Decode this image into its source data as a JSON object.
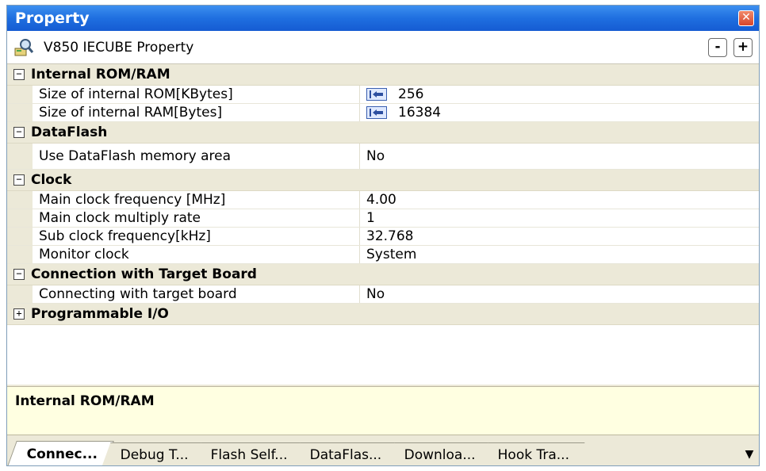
{
  "window": {
    "title": "Property",
    "close_glyph": "✕"
  },
  "toolbar": {
    "panel_name": "V850 IECUBE Property",
    "collapse_label": "-",
    "expand_label": "+",
    "icon": "property-icon"
  },
  "categories": [
    {
      "label": "Internal ROM/RAM",
      "toggle": "−",
      "props": [
        {
          "name": "Size of internal ROM[KBytes]",
          "value": "256",
          "ref": true
        },
        {
          "name": "Size of internal RAM[Bytes]",
          "value": "16384",
          "ref": true
        }
      ]
    },
    {
      "label": "DataFlash",
      "toggle": "−",
      "props": [
        {
          "name": "Use DataFlash memory area",
          "value": "No"
        }
      ]
    },
    {
      "label": "Clock",
      "toggle": "−",
      "props": [
        {
          "name": "Main clock frequency [MHz]",
          "value": "4.00"
        },
        {
          "name": "Main clock multiply rate",
          "value": "1"
        },
        {
          "name": "Sub clock frequency[kHz]",
          "value": "32.768"
        },
        {
          "name": "Monitor clock",
          "value": "System"
        }
      ]
    },
    {
      "label": "Connection with Target Board",
      "toggle": "−",
      "props": [
        {
          "name": "Connecting with target board",
          "value": "No"
        }
      ]
    },
    {
      "label": "Programmable I/O",
      "toggle": "+",
      "props": []
    }
  ],
  "description": {
    "title": "Internal ROM/RAM"
  },
  "tabs": [
    {
      "label": "Connec...",
      "active": true
    },
    {
      "label": "Debug T...",
      "active": false
    },
    {
      "label": "Flash Self...",
      "active": false
    },
    {
      "label": "DataFlas...",
      "active": false
    },
    {
      "label": "Downloa...",
      "active": false
    },
    {
      "label": "Hook Tra...",
      "active": false
    }
  ],
  "tab_more_glyph": "▼"
}
